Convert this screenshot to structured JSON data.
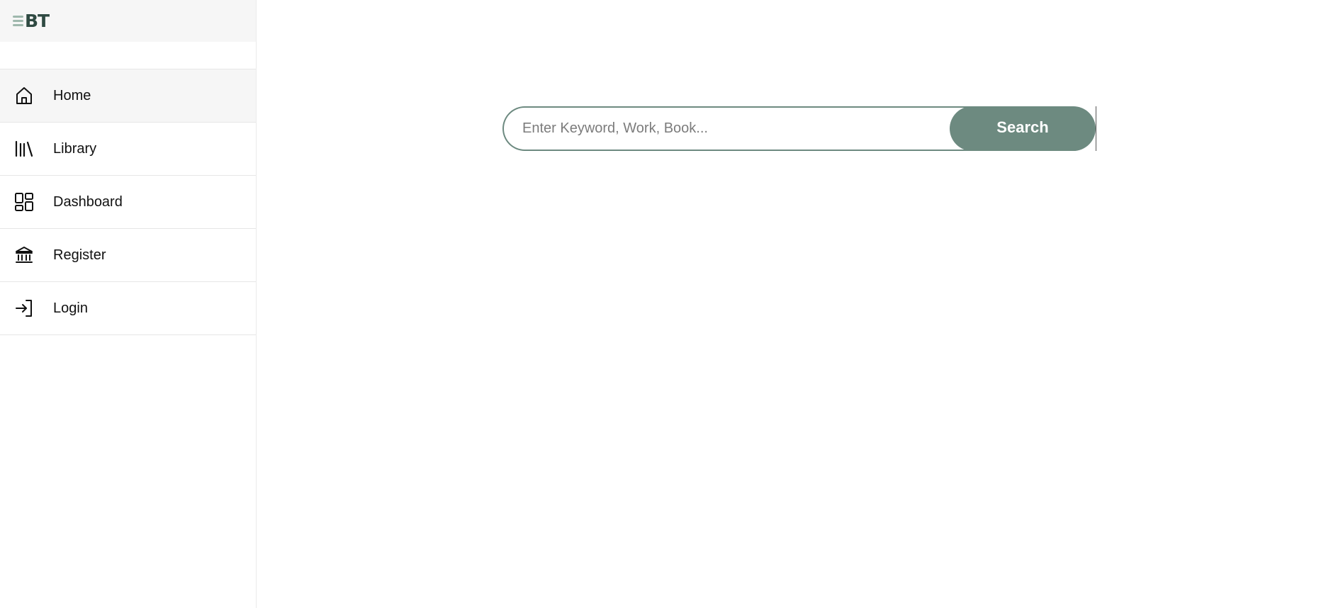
{
  "brand": {
    "logo_text": "BT",
    "logo_color": "#2f4a42",
    "logo_lines_color": "#9fb8ad"
  },
  "sidebar": {
    "items": [
      {
        "label": "Home",
        "icon": "home-icon",
        "active": true
      },
      {
        "label": "Library",
        "icon": "library-icon",
        "active": false
      },
      {
        "label": "Dashboard",
        "icon": "dashboard-icon",
        "active": false
      },
      {
        "label": "Register",
        "icon": "bank-icon",
        "active": false
      },
      {
        "label": "Login",
        "icon": "login-icon",
        "active": false
      }
    ]
  },
  "search": {
    "placeholder": "Enter Keyword, Work, Book...",
    "value": "",
    "button_label": "Search",
    "accent_color": "#6d8a80"
  }
}
